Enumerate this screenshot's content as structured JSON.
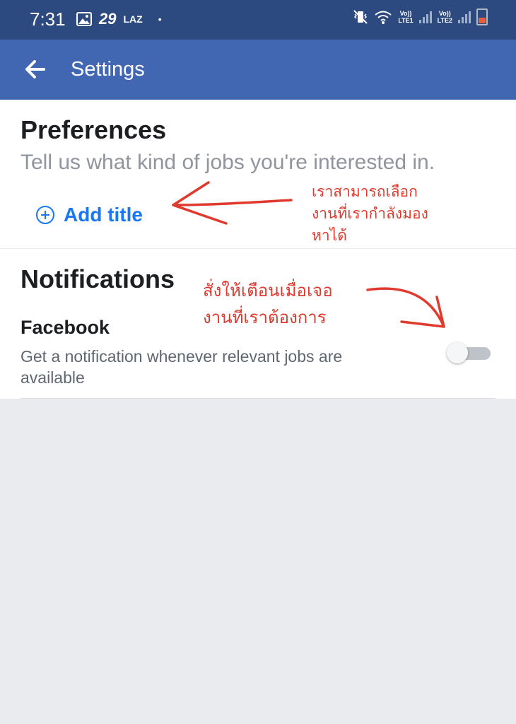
{
  "status_bar": {
    "time": "7:31",
    "notification_count": "29",
    "carrier_badge": "LAZ",
    "dot": "•",
    "sim1_label": "Vo))",
    "sim1_type": "LTE1",
    "sim2_label": "Vo))",
    "sim2_type": "LTE2"
  },
  "app_bar": {
    "back_icon": "arrow-left-icon",
    "title": "Settings"
  },
  "preferences": {
    "title": "Preferences",
    "description": "Tell us what kind of jobs you're interested in.",
    "add_title_label": "Add title",
    "add_icon": "plus-circle-icon"
  },
  "notifications": {
    "title": "Notifications",
    "facebook_label": "Facebook",
    "facebook_description": "Get a notification whenever relevant jobs are available",
    "toggle_on": false
  },
  "annotations": {
    "preferences_note": [
      "เราสามารถเลือก",
      "งานที่เรากำลังมอง",
      "หาได้"
    ],
    "notifications_note": [
      "สั่งให้เตือนเมื่อเจอ",
      "งานที่เราต้องการ"
    ]
  },
  "colors": {
    "status_bar": "#2d4a80",
    "app_bar": "#4267b2",
    "link_blue": "#1877f2",
    "annotation_red": "#e03a2e",
    "page_background": "#e9ebee"
  }
}
